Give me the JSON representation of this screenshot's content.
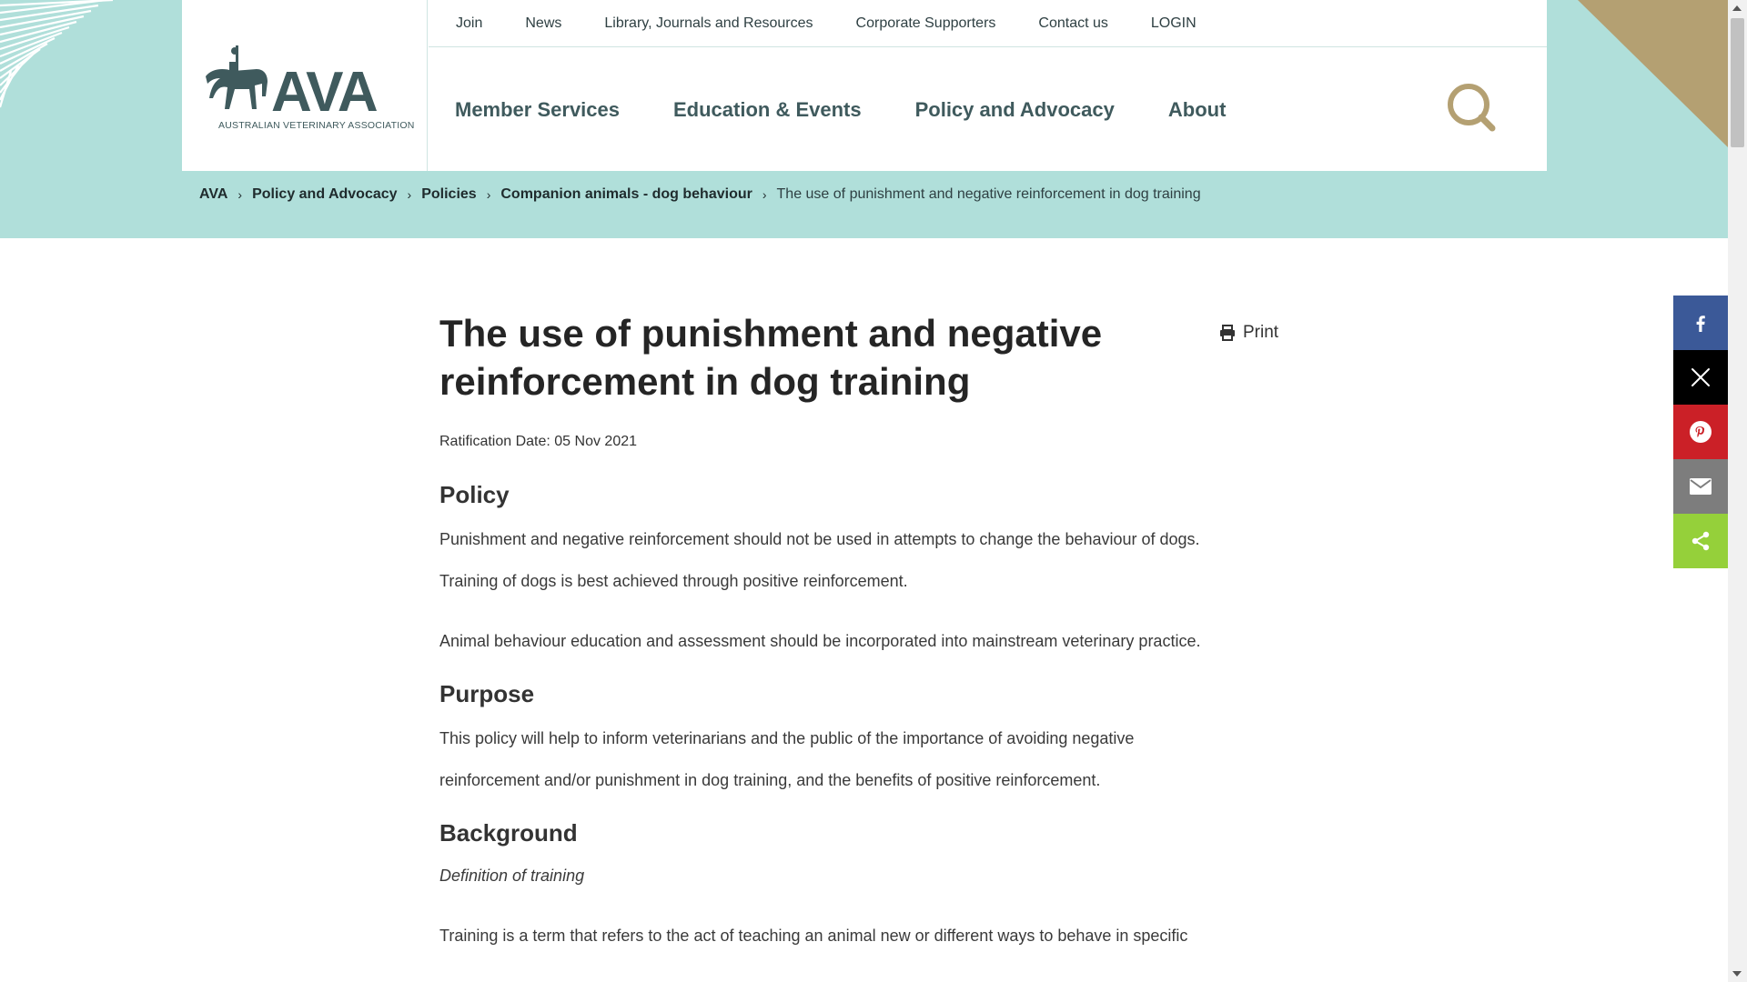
{
  "header": {
    "logo_text": "AVA",
    "logo_subtitle": "AUSTRALIAN VETERINARY ASSOCIATION",
    "top_nav": [
      "Join",
      "News",
      "Library, Journals and Resources",
      "Corporate Supporters",
      "Contact us",
      "LOGIN"
    ],
    "main_nav": [
      "Member Services",
      "Education & Events",
      "Policy and Advocacy",
      "About"
    ],
    "search_icon": "search-icon"
  },
  "breadcrumb": {
    "links": [
      "AVA",
      "Policy and Advocacy",
      "Policies",
      "Companion animals - dog behaviour"
    ],
    "separator": "›",
    "current": "The use of punishment and negative reinforcement in dog training"
  },
  "article": {
    "title": "The use of punishment and negative reinforcement in dog training",
    "print_label": "Print",
    "ratification_date": "Ratification Date: 05 Nov 2021",
    "sections": {
      "policy": {
        "heading": "Policy",
        "paragraphs": [
          "Punishment and negative reinforcement should not be used in attempts to change the behaviour of dogs.",
          "Training of dogs is best achieved through positive reinforcement.",
          "Animal behaviour education and assessment should be incorporated into mainstream veterinary practice."
        ]
      },
      "purpose": {
        "heading": "Purpose",
        "paragraphs": [
          "This policy will help to inform veterinarians and the public of the importance of avoiding negative reinforcement and/or punishment in dog training, and the benefits of positive reinforcement."
        ]
      },
      "background": {
        "heading": "Background",
        "subheading": "Definition of training",
        "paragraphs": [
          "Training is a term that refers to the act of teaching an animal new or different ways to behave in specific"
        ]
      }
    }
  },
  "share": {
    "buttons": [
      {
        "icon": "facebook-icon",
        "color": "#3b5998"
      },
      {
        "icon": "x-icon",
        "color": "#000000"
      },
      {
        "icon": "pinterest-icon",
        "color": "#cb2027"
      },
      {
        "icon": "email-icon",
        "color": "#7d7d7d"
      },
      {
        "icon": "share-icon",
        "color": "#95d03a"
      }
    ]
  },
  "colors": {
    "hero_bg": "#b0dfda",
    "brand_dark": "#3f5a5d",
    "accent_gold": "#b4a072"
  }
}
